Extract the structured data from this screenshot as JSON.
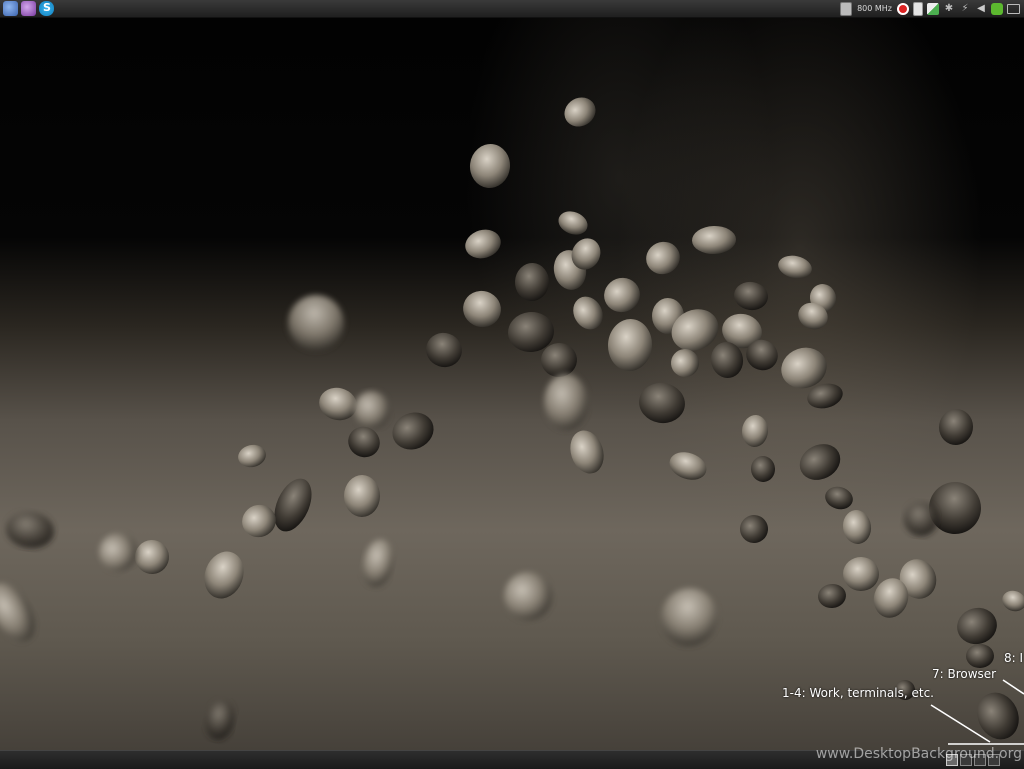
{
  "top_panel": {
    "launchers": [
      {
        "icon": "mail-client-icon",
        "color": "#4a78c4"
      },
      {
        "icon": "messenger-icon",
        "color": "#9a5fc0"
      },
      {
        "icon": "skype-icon",
        "color": "#1fa3e4"
      }
    ],
    "cpu_frequency": "800 MHz",
    "tray_icons": [
      "cpu-frequency-icon",
      "no-entry-icon",
      "battery-icon",
      "network-icon",
      "bluetooth-icon",
      "wireless-icon",
      "volume-icon",
      "update-check-icon",
      "mail-envelope-icon"
    ]
  },
  "annotations": {
    "work": "1-4: Work, terminals, etc.",
    "browser": "7: Browser",
    "eight": "8: I"
  },
  "bottom_panel": {
    "workspaces": 4,
    "active_workspace": 1
  },
  "watermark": "www.DesktopBackground.org"
}
